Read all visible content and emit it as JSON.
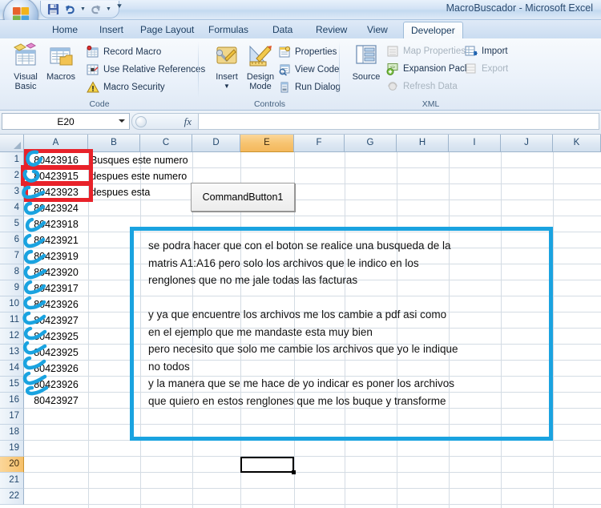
{
  "window": {
    "title": "MacroBuscador - Microsoft Excel"
  },
  "quick_access": {
    "save_label": "Save",
    "undo_label": "Undo",
    "redo_label": "Redo",
    "customize_label": "Customize Quick Access Toolbar"
  },
  "office_button": {
    "label": "Office Button"
  },
  "tabs": [
    {
      "label": "Home",
      "active": false
    },
    {
      "label": "Insert",
      "active": false
    },
    {
      "label": "Page Layout",
      "active": false
    },
    {
      "label": "Formulas",
      "active": false
    },
    {
      "label": "Data",
      "active": false
    },
    {
      "label": "Review",
      "active": false
    },
    {
      "label": "View",
      "active": false
    },
    {
      "label": "Developer",
      "active": true
    }
  ],
  "ribbon": {
    "groups": [
      {
        "name": "Code",
        "big_buttons": [
          {
            "label_line1": "Visual",
            "label_line2": "Basic",
            "icon": "visual-basic-icon"
          },
          {
            "label_line1": "Macros",
            "label_line2": "",
            "icon": "macros-icon"
          }
        ],
        "small_items": [
          {
            "label": "Record Macro",
            "icon": "record-macro-icon",
            "disabled": false
          },
          {
            "label": "Use Relative References",
            "icon": "relative-refs-icon",
            "disabled": false
          },
          {
            "label": "Macro Security",
            "icon": "macro-security-icon",
            "disabled": false
          }
        ]
      },
      {
        "name": "Controls",
        "big_buttons": [
          {
            "label_line1": "Insert",
            "label_line2": "",
            "icon": "insert-control-icon",
            "dropdown": true
          },
          {
            "label_line1": "Design",
            "label_line2": "Mode",
            "icon": "design-mode-icon"
          }
        ],
        "small_items": [
          {
            "label": "Properties",
            "icon": "properties-icon",
            "disabled": false
          },
          {
            "label": "View Code",
            "icon": "view-code-icon",
            "disabled": false
          },
          {
            "label": "Run Dialog",
            "icon": "run-dialog-icon",
            "disabled": false
          }
        ]
      },
      {
        "name": "XML",
        "big_buttons": [
          {
            "label_line1": "Source",
            "label_line2": "",
            "icon": "xml-source-icon"
          }
        ],
        "small_items": [
          {
            "label": "Map Properties",
            "icon": "map-properties-icon",
            "disabled": true
          },
          {
            "label": "Expansion Packs",
            "icon": "expansion-packs-icon",
            "disabled": false
          },
          {
            "label": "Refresh Data",
            "icon": "refresh-data-icon",
            "disabled": true
          },
          {
            "label": "Import",
            "icon": "import-icon",
            "disabled": false
          },
          {
            "label": "Export",
            "icon": "export-icon",
            "disabled": true
          }
        ]
      }
    ]
  },
  "formula_bar": {
    "name_box_value": "E20",
    "formula_value": "",
    "fx_label": "fx"
  },
  "sheet": {
    "columns": [
      "A",
      "B",
      "C",
      "D",
      "E",
      "F",
      "G",
      "H",
      "I",
      "J",
      "K"
    ],
    "selected_column": "E",
    "rows": [
      1,
      2,
      3,
      4,
      5,
      6,
      7,
      8,
      9,
      10,
      11,
      12,
      13,
      14,
      15,
      16,
      17,
      18,
      19,
      20,
      21,
      22
    ],
    "selected_row": 20,
    "selected_cell": "E20",
    "column_a": [
      "80423916",
      "80423915",
      "80423923",
      "80423924",
      "80423918",
      "80423921",
      "80423919",
      "80423920",
      "80423917",
      "80423926",
      "80423927",
      "80423925",
      "80423925",
      "80423926",
      "80423926",
      "80423927"
    ],
    "text_cells": [
      {
        "row": 1,
        "text": "Busques este numero"
      },
      {
        "row": 2,
        "text": "despues este numero"
      },
      {
        "row": 3,
        "text": "despues esta"
      }
    ]
  },
  "command_button": {
    "label": "CommandButton1"
  },
  "annotations": {
    "red_boxes_label": "red-highlight-cells-A1-A3",
    "blue_squiggle_label": "blue-brace-marking-rows",
    "blue_box_label": "blue-note-box",
    "note_text": "se podra hacer que con el boton se realice una busqueda de la\nmatris A1:A16 pero solo los archivos que le indico en los\nrenglones que no me jale todas las facturas\n\ny ya que encuentre los archivos me los cambie a pdf asi como\nen el ejemplo que me mandaste esta muy bien\npero necesito que solo me cambie los archivos que yo le indique\nno todos\ny la manera que se me hace de yo indicar es poner los archivos\nque quiero en estos renglones que me los buque y transforme"
  },
  "colors": {
    "red_annotation": "#e8222a",
    "blue_annotation": "#1aa3e0",
    "selection_orange": "#f7c471",
    "header_blue": "#23486d"
  }
}
